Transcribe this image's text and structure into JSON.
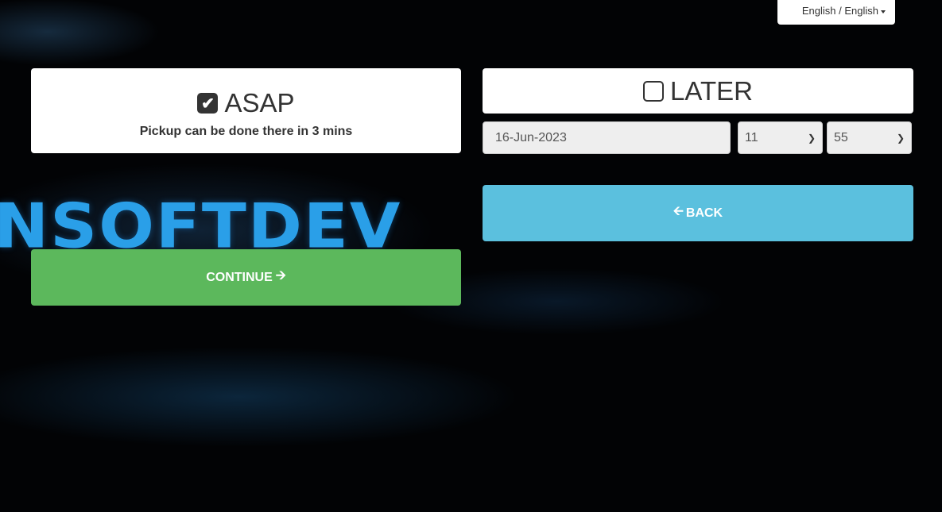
{
  "language": {
    "label": "English / English",
    "icon": "caret-down-icon"
  },
  "logo_text": "INSOFTDEV",
  "asap": {
    "label": "ASAP",
    "checked": true,
    "subtitle": "Pickup can be done there in 3 mins"
  },
  "later": {
    "label": "LATER",
    "checked": false,
    "date": "16-Jun-2023",
    "hour": "11",
    "minute": "55"
  },
  "buttons": {
    "back": "BACK",
    "continue": "CONTINUE"
  },
  "colors": {
    "continue": "#5cb85c",
    "back": "#5bc0de"
  }
}
